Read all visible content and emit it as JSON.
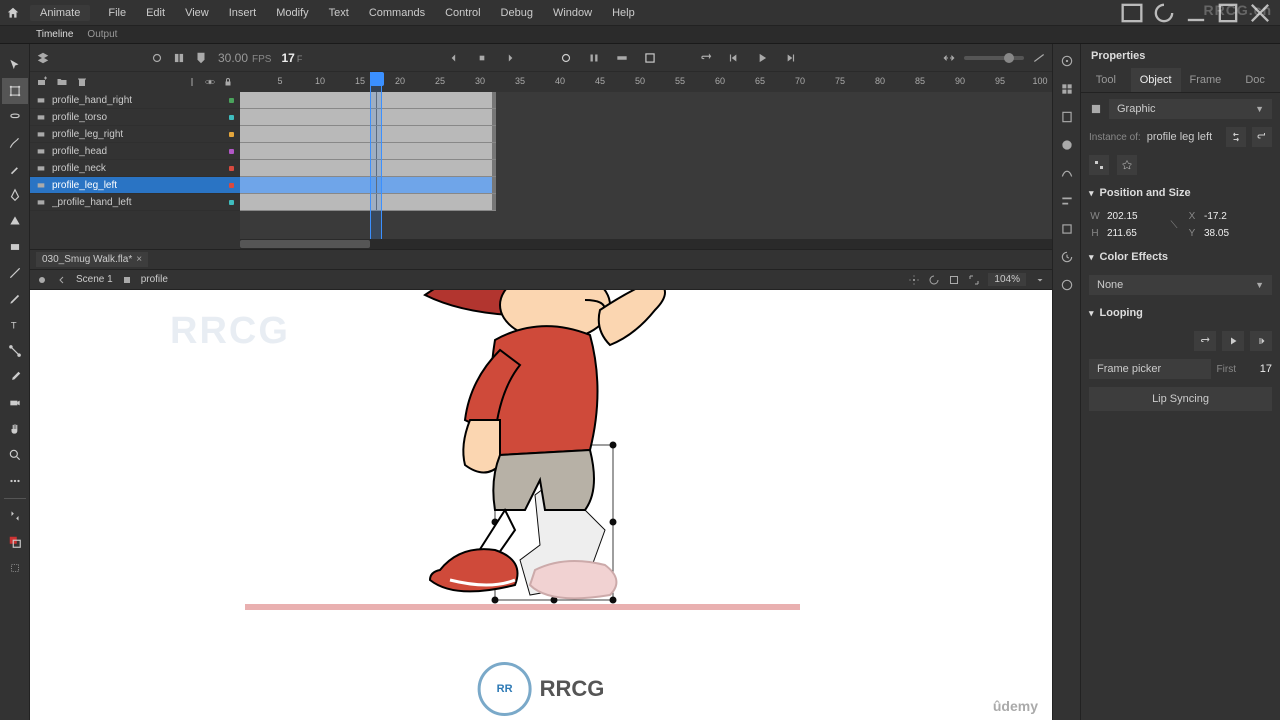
{
  "app": {
    "label": "Animate"
  },
  "menus": [
    "File",
    "Edit",
    "View",
    "Insert",
    "Modify",
    "Text",
    "Commands",
    "Control",
    "Debug",
    "Window",
    "Help"
  ],
  "subtabs": {
    "timeline": "Timeline",
    "output": "Output",
    "active": "timeline"
  },
  "timeline": {
    "fps": "30.00",
    "fps_unit": "FPS",
    "current_frame": "17",
    "frame_unit": "F",
    "ticks": [
      5,
      10,
      15,
      20,
      25,
      30,
      35,
      40,
      45,
      50,
      55,
      60,
      65,
      70,
      75,
      80,
      85,
      90,
      95,
      100
    ],
    "span_end_frame": 32,
    "playhead_frame": 17
  },
  "layers": [
    {
      "name": "profile_hand_right",
      "color": "#4aa35c"
    },
    {
      "name": "profile_torso",
      "color": "#3fbdbf"
    },
    {
      "name": "profile_leg_right",
      "color": "#e4a63c"
    },
    {
      "name": "profile_head",
      "color": "#b257c7"
    },
    {
      "name": "profile_neck",
      "color": "#d84a3f"
    },
    {
      "name": "profile_leg_left",
      "color": "#d84a3f",
      "selected": true
    },
    {
      "name": "_profile_hand_left",
      "color": "#3fbdbf"
    }
  ],
  "document": {
    "tab_name": "030_Smug Walk.fla*",
    "scene": "Scene 1",
    "symbol": "profile",
    "zoom": "104%"
  },
  "properties": {
    "title": "Properties",
    "tabs": [
      "Tool",
      "Object",
      "Frame",
      "Doc"
    ],
    "active_tab": "Object",
    "type": "Graphic",
    "instance_of_label": "Instance of:",
    "instance_of": "profile leg left",
    "pos_size_title": "Position and Size",
    "W": "202.15",
    "X": "-17.2",
    "H": "211.65",
    "Y": "38.05",
    "color_effects_title": "Color Effects",
    "color_effect": "None",
    "looping_title": "Looping",
    "frame_picker_label": "Frame picker",
    "first_label": "First",
    "first_value": "17",
    "lip_sync": "Lip Syncing"
  },
  "watermark": "RRCG",
  "watermark_url": "RRCG.cn",
  "footer": {
    "logo": "RR",
    "brand": "RRCG"
  },
  "vendor": "ûdemy"
}
